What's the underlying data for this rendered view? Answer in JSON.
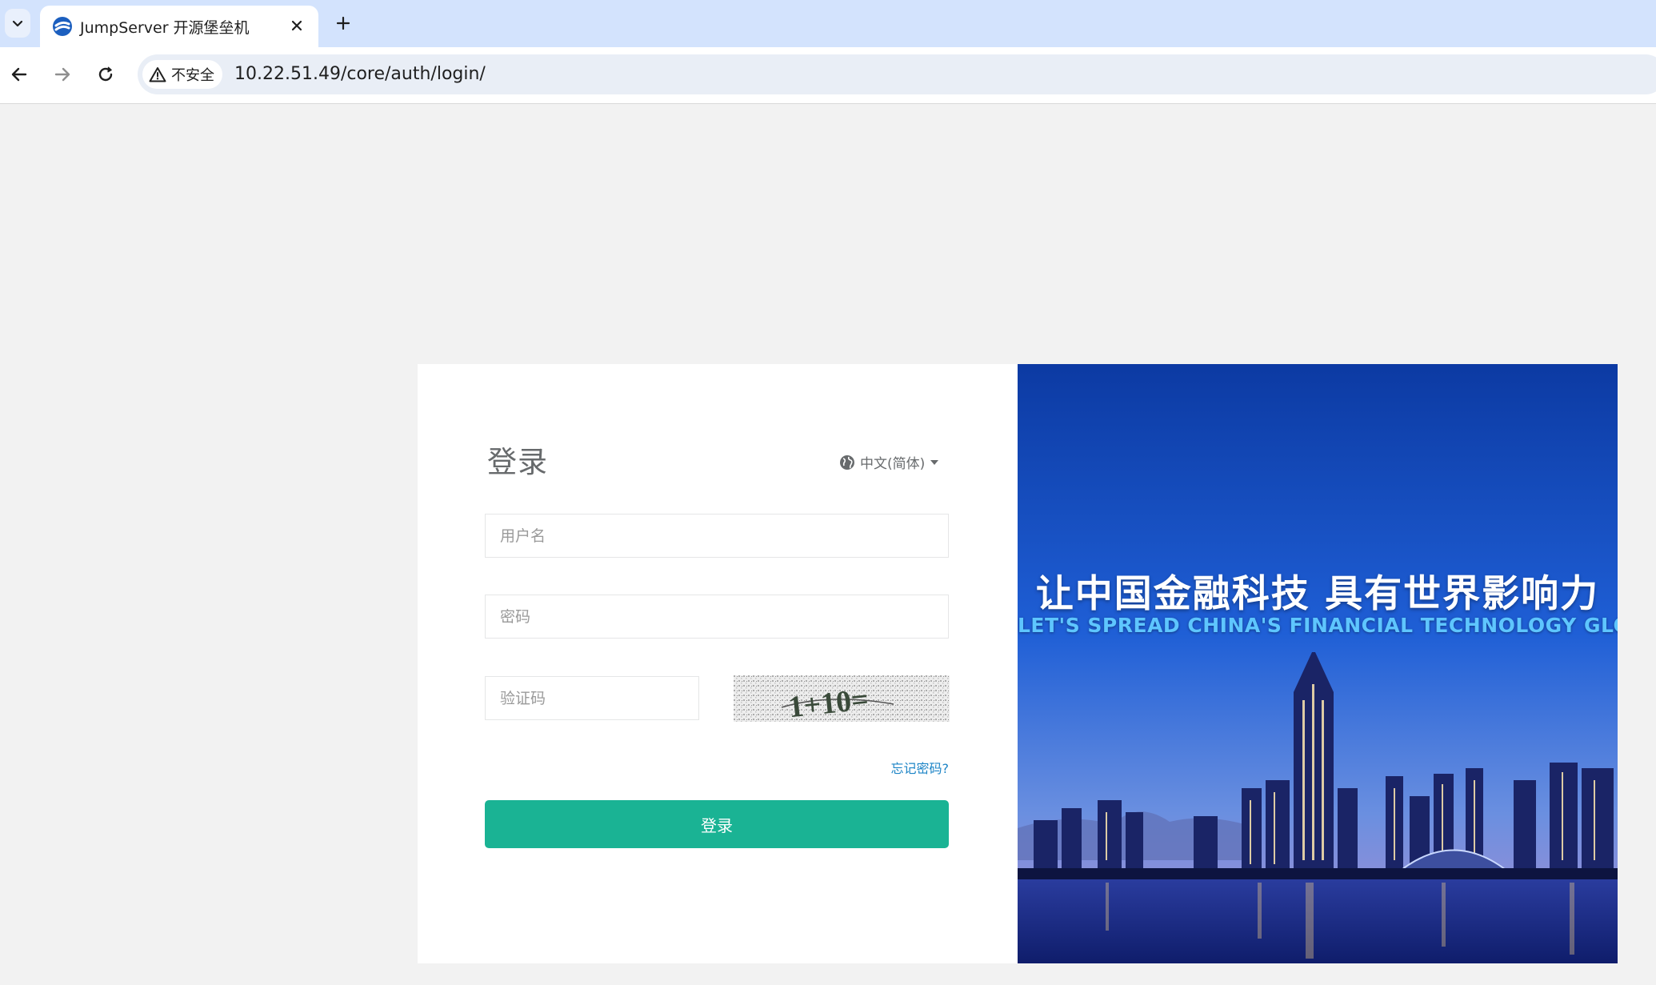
{
  "browser": {
    "tab": {
      "title": "JumpServer 开源堡垒机",
      "favicon": "jumpserver-logo-icon"
    },
    "address_bar": {
      "security_label": "不安全",
      "url": "10.22.51.49/core/auth/login/"
    }
  },
  "login": {
    "title": "登录",
    "language": "中文(简体)",
    "username_placeholder": "用户名",
    "password_placeholder": "密码",
    "captcha_placeholder": "验证码",
    "captcha_text": "1+10=",
    "forgot_password": "忘记密码?",
    "submit_label": "登录"
  },
  "banner": {
    "title": "让中国金融科技 具有世界影响力",
    "subtitle": "LET'S SPREAD CHINA'S FINANCIAL TECHNOLOGY GLOBALLY"
  },
  "colors": {
    "primary_button": "#1ab394",
    "link": "#1c84c6",
    "tabbar": "#d3e3fd",
    "page_background": "#f2f2f2"
  }
}
